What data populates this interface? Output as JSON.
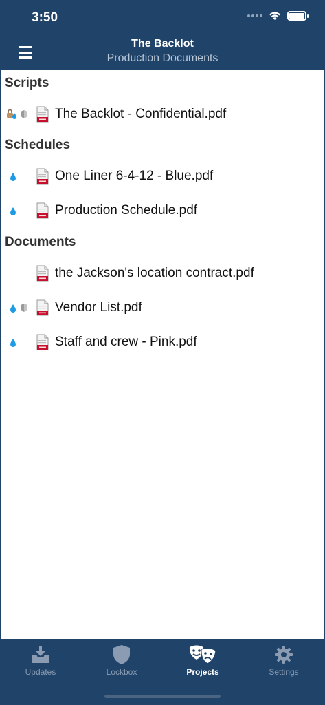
{
  "status_bar": {
    "time": "3:50"
  },
  "header": {
    "title": "The Backlot",
    "subtitle": "Production Documents"
  },
  "sections": [
    {
      "title": "Scripts",
      "items": [
        {
          "label": "The Backlot - Confidential.pdf",
          "badges": [
            "lock-drop-icon",
            "shield-icon"
          ]
        }
      ]
    },
    {
      "title": "Schedules",
      "items": [
        {
          "label": "One Liner 6-4-12 - Blue.pdf",
          "badges": [
            "drop-icon"
          ]
        },
        {
          "label": "Production Schedule.pdf",
          "badges": [
            "drop-icon"
          ]
        }
      ]
    },
    {
      "title": "Documents",
      "items": [
        {
          "label": "the Jackson's location contract.pdf",
          "badges": []
        },
        {
          "label": "Vendor List.pdf",
          "badges": [
            "drop-icon",
            "shield-icon"
          ]
        },
        {
          "label": "Staff and crew - Pink.pdf",
          "badges": [
            "drop-icon"
          ]
        }
      ]
    }
  ],
  "tabs": [
    {
      "label": "Updates",
      "icon": "inbox-download-icon",
      "active": false
    },
    {
      "label": "Lockbox",
      "icon": "shield-icon",
      "active": false
    },
    {
      "label": "Projects",
      "icon": "theater-masks-icon",
      "active": true
    },
    {
      "label": "Settings",
      "icon": "gear-icon",
      "active": false
    }
  ],
  "colors": {
    "navy": "#20436a",
    "drop_blue": "#1f9be6",
    "pdf_red": "#c8102e",
    "tab_inactive": "#8b9cb2"
  }
}
